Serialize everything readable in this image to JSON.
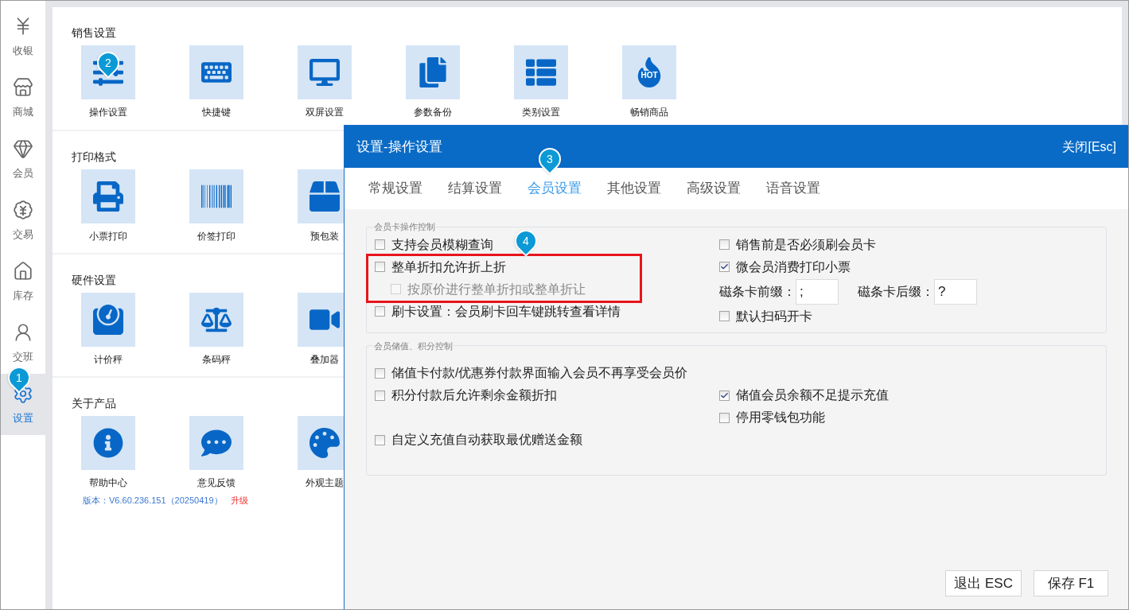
{
  "sidebar": {
    "items": [
      {
        "label": "收银",
        "selected": false
      },
      {
        "label": "商城",
        "selected": false
      },
      {
        "label": "会员",
        "selected": false
      },
      {
        "label": "交易",
        "selected": false
      },
      {
        "label": "库存",
        "selected": false
      },
      {
        "label": "交班",
        "selected": false
      },
      {
        "label": "设置",
        "selected": true
      }
    ]
  },
  "sections": [
    {
      "title": "销售设置",
      "tiles": [
        {
          "label": "操作设置"
        },
        {
          "label": "快捷键"
        },
        {
          "label": "双屏设置"
        },
        {
          "label": "参数备份"
        },
        {
          "label": "类别设置"
        },
        {
          "label": "畅销商品",
          "badge": "HOT"
        }
      ]
    },
    {
      "title": "打印格式",
      "tiles": [
        {
          "label": "小票打印"
        },
        {
          "label": "价签打印"
        },
        {
          "label": "预包装"
        }
      ]
    },
    {
      "title": "硬件设置",
      "tiles": [
        {
          "label": "计价秤"
        },
        {
          "label": "条码秤"
        },
        {
          "label": "叠加器"
        }
      ]
    },
    {
      "title": "关于产品",
      "tiles": [
        {
          "label": "帮助中心"
        },
        {
          "label": "意见反馈"
        },
        {
          "label": "外观主题"
        }
      ]
    }
  ],
  "version": {
    "text": "版本：V6.60.236.151（20250419）",
    "link": "升级"
  },
  "dialog": {
    "title": "设置-操作设置",
    "close": "关闭[Esc]",
    "tabs": [
      {
        "label": "常规设置",
        "selected": false
      },
      {
        "label": "结算设置",
        "selected": false
      },
      {
        "label": "会员设置",
        "selected": true
      },
      {
        "label": "其他设置",
        "selected": false
      },
      {
        "label": "高级设置",
        "selected": false
      },
      {
        "label": "语音设置",
        "selected": false
      }
    ],
    "card_group": {
      "title": "会员卡操作控制",
      "left": [
        {
          "kind": "checkbox",
          "label": "支持会员模糊查询",
          "checked": false,
          "disabled": false,
          "highlighted": false
        },
        {
          "kind": "checkbox",
          "label": "整单折扣允许折上折",
          "checked": false,
          "disabled": false,
          "highlighted": true,
          "children": [
            {
              "kind": "checkbox",
              "label": "按原价进行整单折扣或整单折让",
              "checked": false,
              "disabled": true,
              "highlighted": false
            }
          ]
        },
        {
          "kind": "checkbox",
          "label": "刷卡设置：会员刷卡回车键跳转查看详情",
          "checked": false,
          "disabled": false,
          "highlighted": false
        }
      ],
      "right": [
        {
          "kind": "checkbox",
          "label": "销售前是否必须刷会员卡",
          "checked": false,
          "disabled": false,
          "highlighted": false
        },
        {
          "kind": "checkbox",
          "label": "微会员消费打印小票",
          "checked": true,
          "disabled": false,
          "highlighted": false
        },
        {
          "kind": "fields",
          "fields": [
            {
              "label": "磁条卡前缀：",
              "value": ";"
            },
            {
              "label": "磁条卡后缀：",
              "value": "?"
            }
          ]
        },
        {
          "kind": "checkbox",
          "label": "默认扫码开卡",
          "checked": false,
          "disabled": false,
          "highlighted": false
        }
      ]
    },
    "value_group": {
      "title": "会员储值、积分控制",
      "rows": [
        {
          "left": {
            "kind": "checkbox",
            "label": "储值卡付款/优惠券付款界面输入会员不再享受会员价",
            "checked": false,
            "disabled": false,
            "highlighted": false
          }
        },
        {
          "left": {
            "kind": "checkbox",
            "label": "积分付款后允许剩余金额折扣",
            "checked": false,
            "disabled": false,
            "highlighted": false
          },
          "right": {
            "kind": "checkbox",
            "label": "储值会员余额不足提示充值",
            "checked": true,
            "disabled": false,
            "highlighted": false
          }
        },
        {
          "right": {
            "kind": "checkbox",
            "label": "停用零钱包功能",
            "checked": false,
            "disabled": false,
            "highlighted": false
          }
        },
        {
          "left": {
            "kind": "checkbox",
            "label": "自定义充值自动获取最优赠送金额",
            "checked": false,
            "disabled": false,
            "highlighted": false
          }
        }
      ]
    },
    "buttons": [
      "退出 ESC",
      "保存 F1"
    ]
  },
  "callouts": [
    {
      "label": "1"
    },
    {
      "label": "2"
    },
    {
      "label": "3"
    },
    {
      "label": "4"
    }
  ]
}
